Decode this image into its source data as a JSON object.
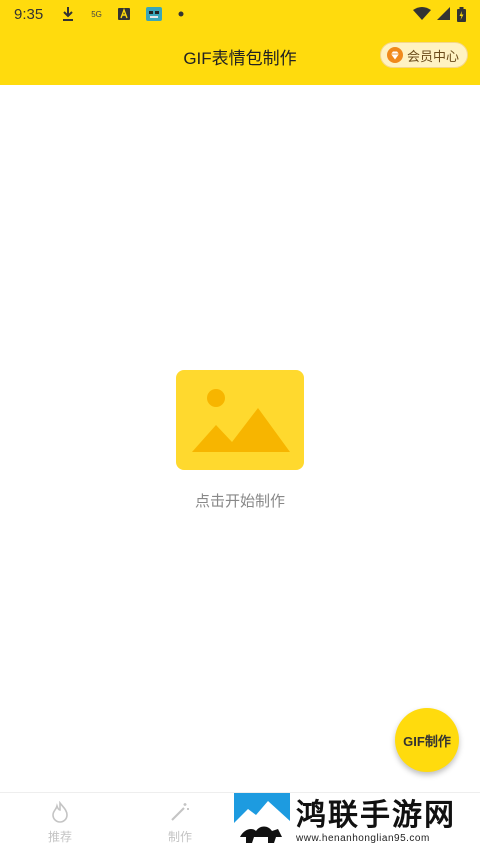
{
  "status_bar": {
    "time": "9:35",
    "network_label": "5G"
  },
  "header": {
    "title": "GIF表情包制作",
    "member_button": "会员中心"
  },
  "empty_state": {
    "text": "点击开始制作"
  },
  "fab": {
    "label": "GIF制作"
  },
  "bottom_nav": {
    "items": [
      {
        "label": "推荐",
        "icon": "flame-icon"
      },
      {
        "label": "制作",
        "icon": "magic-wand-icon"
      }
    ]
  },
  "watermark": {
    "title": "鸿联手游网",
    "url": "www.henanhonglian95.com"
  },
  "colors": {
    "accent": "#ffdb0d",
    "placeholder": "#ffd92e",
    "nav_inactive": "#c4c4c4"
  }
}
